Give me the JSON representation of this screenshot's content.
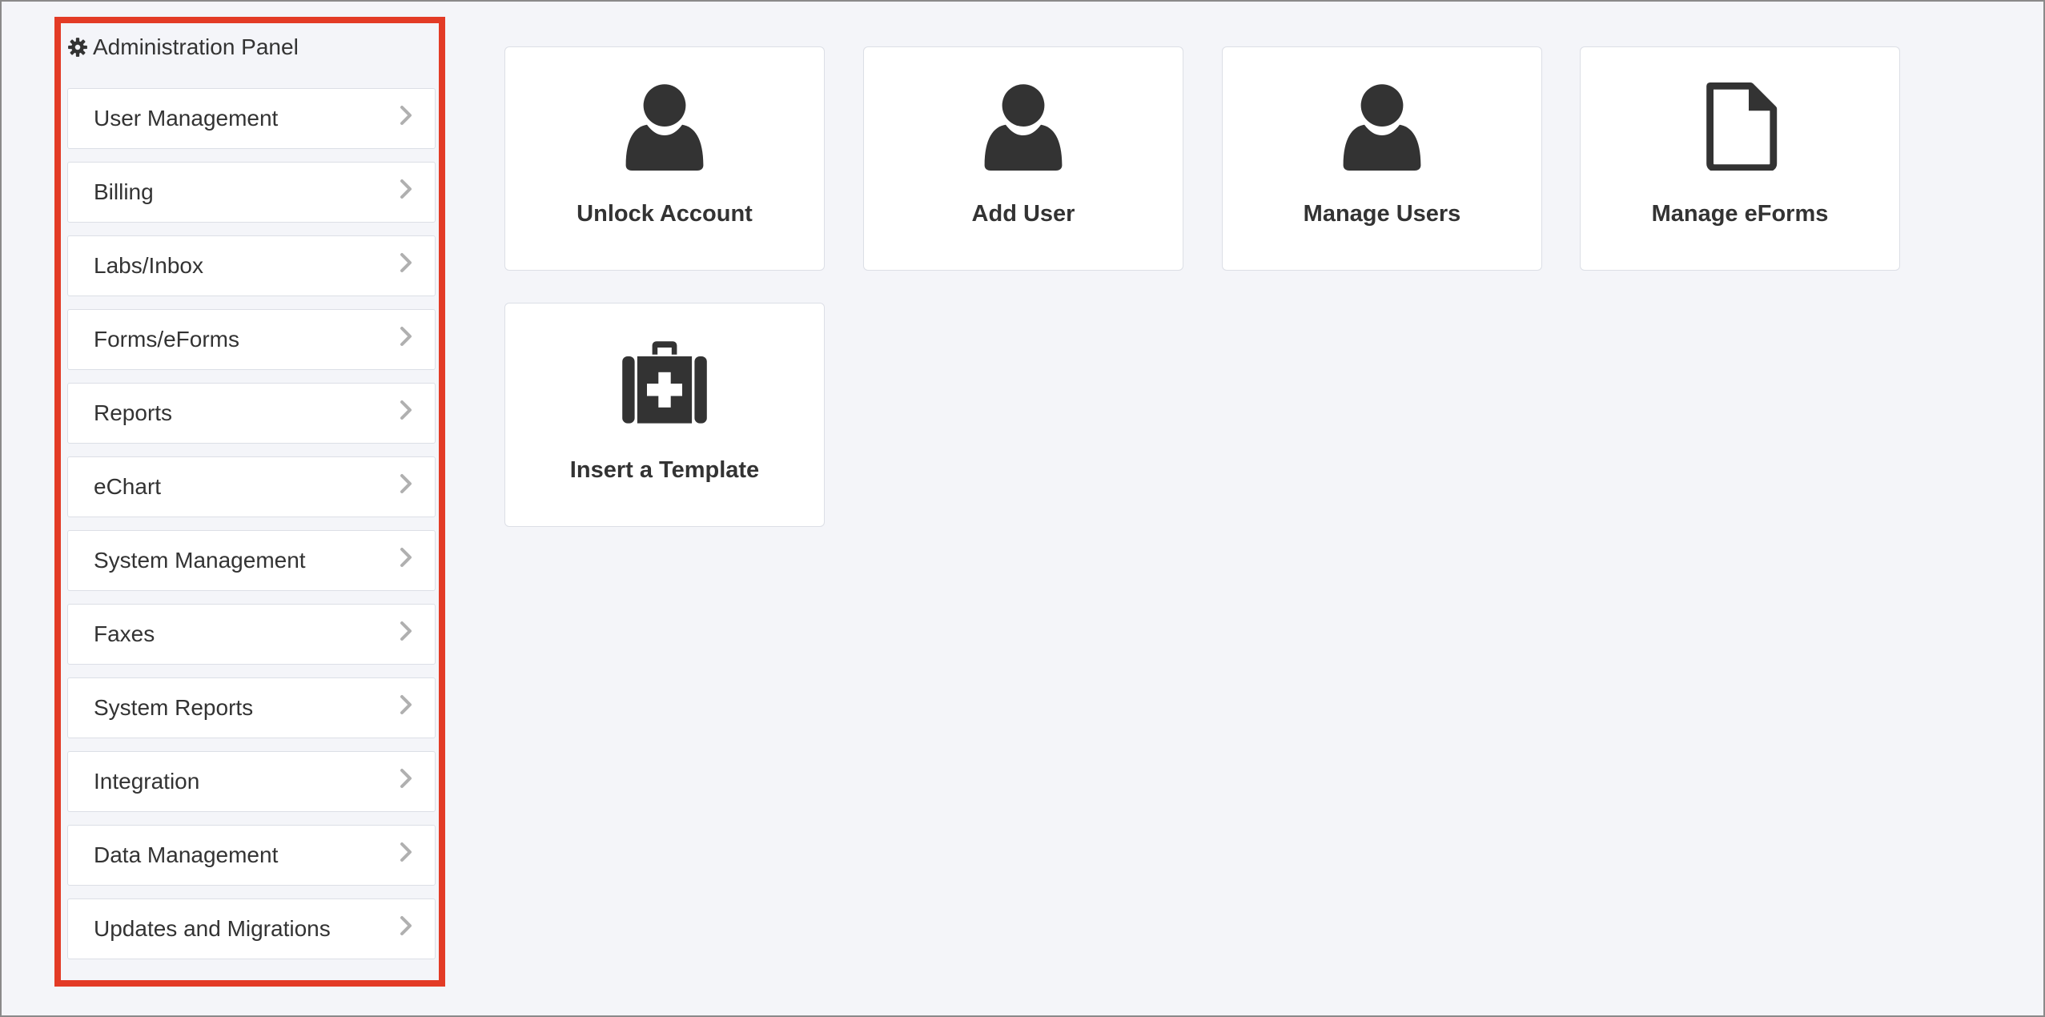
{
  "sidebar": {
    "title": "Administration Panel",
    "title_icon": "gear-icon",
    "items": [
      {
        "label": "User Management"
      },
      {
        "label": "Billing"
      },
      {
        "label": "Labs/Inbox"
      },
      {
        "label": "Forms/eForms"
      },
      {
        "label": "Reports"
      },
      {
        "label": "eChart"
      },
      {
        "label": "System Management"
      },
      {
        "label": "Faxes"
      },
      {
        "label": "System Reports"
      },
      {
        "label": "Integration"
      },
      {
        "label": "Data Management"
      },
      {
        "label": "Updates and Migrations"
      }
    ],
    "highlight_color": "#e33b26"
  },
  "tiles": [
    {
      "label": "Unlock Account",
      "icon": "user-icon"
    },
    {
      "label": "Add User",
      "icon": "user-icon"
    },
    {
      "label": "Manage Users",
      "icon": "user-icon"
    },
    {
      "label": "Manage eForms",
      "icon": "file-icon"
    },
    {
      "label": "Insert a Template",
      "icon": "medkit-icon"
    }
  ],
  "colors": {
    "background": "#f4f5f9",
    "card": "#ffffff",
    "text": "#333333",
    "chevron": "#b0b0b0"
  }
}
